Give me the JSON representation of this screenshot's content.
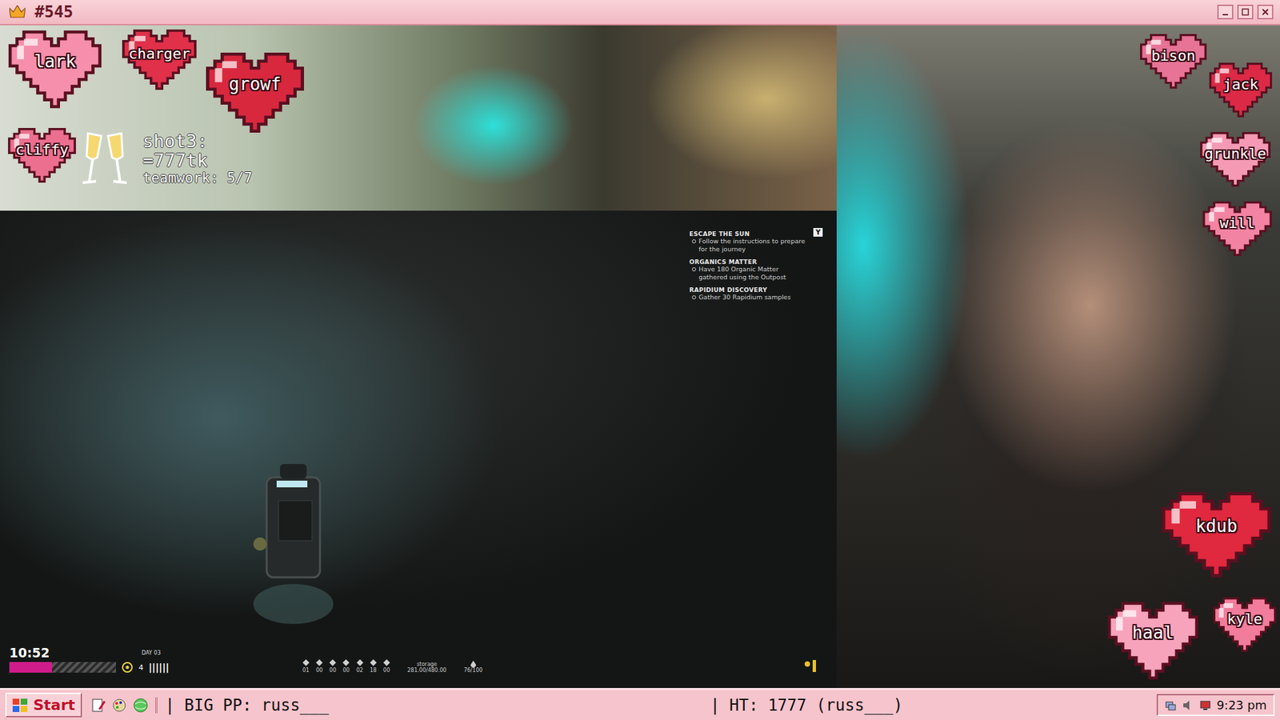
{
  "window": {
    "title": "#545"
  },
  "hearts": [
    {
      "name": "lark",
      "color": "#f58fab"
    },
    {
      "name": "charger",
      "color": "#e0304a"
    },
    {
      "name": "growf",
      "color": "#d8283e"
    },
    {
      "name": "cliffy",
      "color": "#ec6f90"
    },
    {
      "name": "bison",
      "color": "#e77496"
    },
    {
      "name": "jack",
      "color": "#dc2a46"
    },
    {
      "name": "grunkle",
      "color": "#f59ab5"
    },
    {
      "name": "will",
      "color": "#f383a3"
    },
    {
      "name": "kdub",
      "color": "#e0283e"
    },
    {
      "name": "haal",
      "color": "#f8a3bc"
    },
    {
      "name": "kyle",
      "color": "#f27c9c"
    }
  ],
  "drink_counter": {
    "lines": [
      "shot3:",
      "=777tk",
      "teamwork: 5/7"
    ]
  },
  "game": {
    "objectives": [
      {
        "title": "ESCAPE THE SUN",
        "task": "Follow the instructions to prepare for the journey"
      },
      {
        "title": "ORGANICS MATTER",
        "task": "Have 180 Organic Matter gathered using the Outpost"
      },
      {
        "title": "RAPIDIUM DISCOVERY",
        "task": "Gather 30 Rapidium samples"
      }
    ],
    "close_key": "Y",
    "clock": "10:52",
    "day": "DAY 03",
    "energy_level": 0.4,
    "count": "4",
    "bars": "||||||",
    "resources": [
      "01",
      "00",
      "00",
      "00",
      "02",
      "18",
      "00"
    ],
    "storage_label": "storage",
    "storage": "281.00/480.00",
    "capacity": "76/100"
  },
  "taskbar": {
    "start": "Start",
    "segments": [
      "| BIG PP: russ___",
      "| HT: 1777 (russ___)"
    ],
    "clock": "9:23 pm"
  }
}
